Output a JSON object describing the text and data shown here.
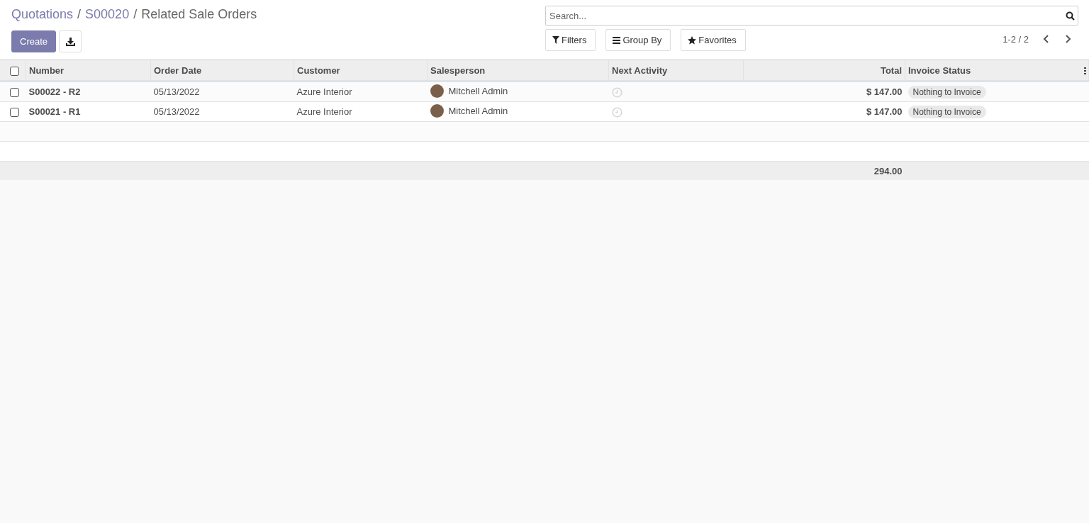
{
  "breadcrumb": [
    {
      "label": "Quotations",
      "kind": "link"
    },
    {
      "label": "S00020",
      "kind": "link"
    },
    {
      "label": "Related Sale Orders",
      "kind": "current"
    }
  ],
  "breadcrumb_separator": "/",
  "buttons": {
    "create": "Create"
  },
  "search": {
    "placeholder": "Search..."
  },
  "filters": [
    "Filters",
    "Group By",
    "Favorites"
  ],
  "pager": {
    "text": "1-2 / 2"
  },
  "table": {
    "select_all_checked": false,
    "columns": [
      {
        "label": "Number"
      },
      {
        "label": "Order Date"
      },
      {
        "label": "Customer"
      },
      {
        "label": "Salesperson"
      },
      {
        "label": "Next Activity"
      },
      {
        "label": "Total"
      },
      {
        "label": "Invoice Status"
      }
    ],
    "rows": [
      {
        "checked": false,
        "number": "S00022 - R2",
        "order_date": "05/13/2022",
        "customer": "Azure Interior",
        "salesperson": "Mitchell Admin",
        "total": "$ 147.00",
        "invoice_status": "Nothing to Invoice"
      },
      {
        "checked": false,
        "number": "S00021 - R1",
        "order_date": "05/13/2022",
        "customer": "Azure Interior",
        "salesperson": "Mitchell Admin",
        "total": "$ 147.00",
        "invoice_status": "Nothing to Invoice"
      }
    ],
    "footer_total": "294.00"
  }
}
